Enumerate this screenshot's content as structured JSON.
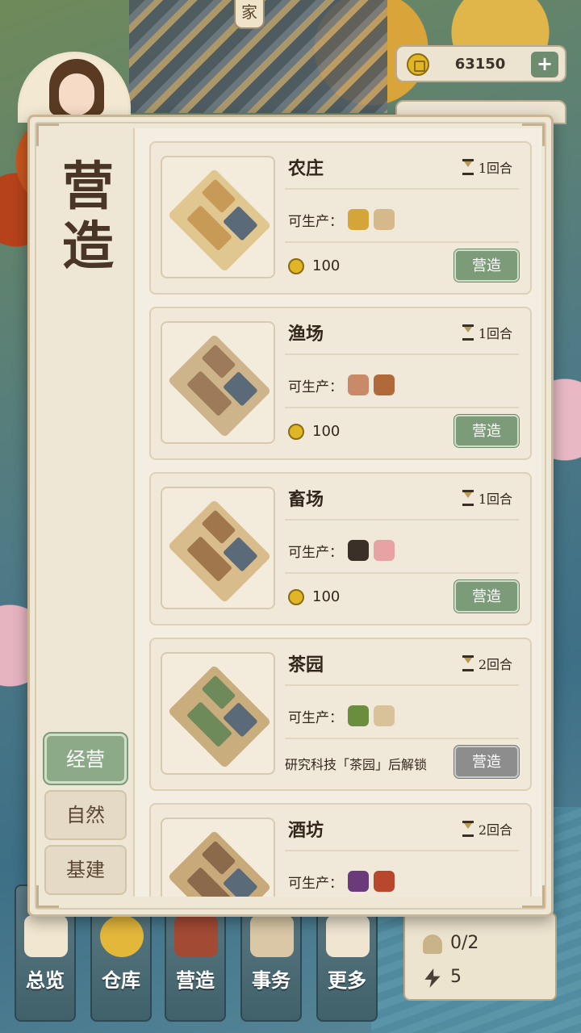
{
  "background": {
    "top_tag": "家"
  },
  "currency": {
    "gold": "63150",
    "plus": "+"
  },
  "panel": {
    "title": "营造",
    "tabs": [
      {
        "label": "经营",
        "active": true
      },
      {
        "label": "自然",
        "active": false
      },
      {
        "label": "基建",
        "active": false
      }
    ],
    "produce_label": "可生产：",
    "build_label": "营造",
    "buildings": [
      {
        "name": "农庄",
        "duration": "1回合",
        "cost": "100",
        "locked": false,
        "products": [
          "wheat-icon",
          "flour-sack-icon"
        ],
        "colors": [
          "#c79a57",
          "#e0c68f"
        ]
      },
      {
        "name": "渔场",
        "duration": "1回合",
        "cost": "100",
        "locked": false,
        "products": [
          "fish-icon",
          "shell-icon"
        ],
        "colors": [
          "#9c7a5a",
          "#cdb48a"
        ]
      },
      {
        "name": "畜场",
        "duration": "1回合",
        "cost": "100",
        "locked": false,
        "products": [
          "cow-icon",
          "meat-icon"
        ],
        "colors": [
          "#a0774d",
          "#d8bc8c"
        ]
      },
      {
        "name": "茶园",
        "duration": "2回合",
        "cost": "",
        "locked": true,
        "lock_text": "研究科技「茶园」后解锁",
        "products": [
          "tea-leaf-icon",
          "tea-cake-icon"
        ],
        "colors": [
          "#6e8a5a",
          "#c9ad7c"
        ]
      },
      {
        "name": "酒坊",
        "duration": "2回合",
        "cost": "",
        "locked": false,
        "products": [
          "grape-icon",
          "wine-jar-icon"
        ],
        "colors": [
          "#8a6a4a",
          "#c8a97a"
        ]
      }
    ]
  },
  "bottom_nav": [
    {
      "label": "总览",
      "icon": "overview-icon"
    },
    {
      "label": "仓库",
      "icon": "warehouse-icon"
    },
    {
      "label": "营造",
      "icon": "build-icon"
    },
    {
      "label": "事务",
      "icon": "affairs-icon"
    },
    {
      "label": "更多",
      "icon": "more-icon"
    }
  ],
  "stats": {
    "workers": "0/2",
    "energy": "5"
  },
  "icon_colors": {
    "wheat-icon": "#d4a63a",
    "flour-sack-icon": "#d6b98a",
    "fish-icon": "#c98a6a",
    "shell-icon": "#b06a3a",
    "cow-icon": "#3a3028",
    "meat-icon": "#e7a3a3",
    "tea-leaf-icon": "#6b8e3e",
    "tea-cake-icon": "#d9c29a",
    "grape-icon": "#6a3a7a",
    "wine-jar-icon": "#b8472e"
  }
}
